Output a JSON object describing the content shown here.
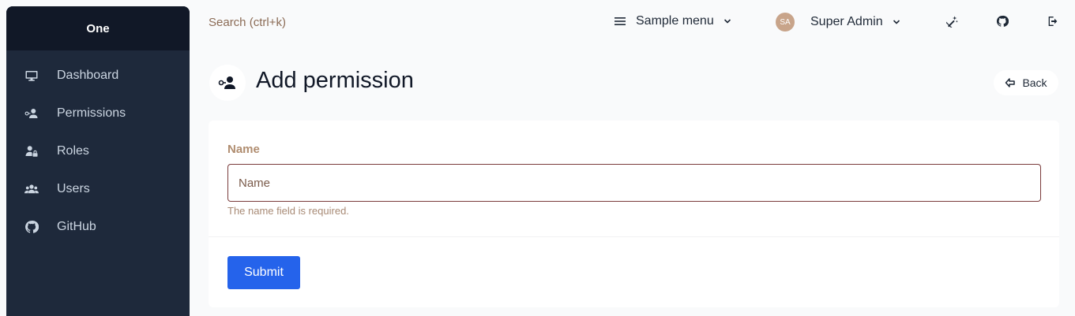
{
  "app": {
    "brand": "One"
  },
  "sidebar": {
    "items": [
      {
        "label": "Dashboard",
        "icon": "monitor-icon"
      },
      {
        "label": "Permissions",
        "icon": "user-key-icon"
      },
      {
        "label": "Roles",
        "icon": "user-lock-icon"
      },
      {
        "label": "Users",
        "icon": "users-icon"
      },
      {
        "label": "GitHub",
        "icon": "github-icon"
      }
    ]
  },
  "topbar": {
    "search_placeholder": "Search (ctrl+k)",
    "menu_label": "Sample menu",
    "user": {
      "initials": "SA",
      "name": "Super Admin"
    },
    "icons": [
      "theme-toggle-icon",
      "github-icon",
      "logout-icon"
    ]
  },
  "page": {
    "title": "Add permission",
    "back_label": "Back"
  },
  "form": {
    "name_label": "Name",
    "name_placeholder": "Name",
    "name_value": "",
    "name_error": "The name field is required.",
    "submit_label": "Submit"
  },
  "colors": {
    "sidebar_bg": "#1e293b",
    "brand_bg": "#111827",
    "primary": "#2563eb",
    "label": "#b08d70",
    "input_border_error": "#7a3b3b"
  }
}
